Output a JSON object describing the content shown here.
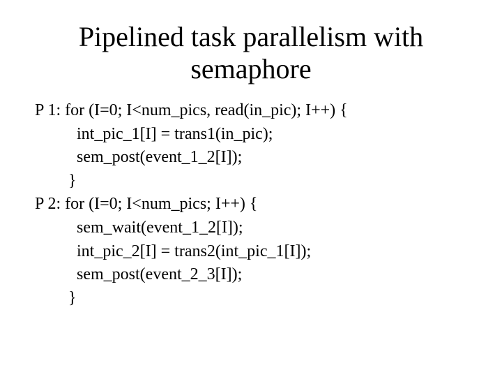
{
  "title_line1": "Pipelined task parallelism with",
  "title_line2": "semaphore",
  "code": {
    "l1": "P 1: for (I=0; I<num_pics, read(in_pic); I++) {",
    "l2": "int_pic_1[I] = trans1(in_pic);",
    "l3": "sem_post(event_1_2[I]);",
    "l4": "}",
    "l5": "P 2: for (I=0; I<num_pics; I++) {",
    "l6": "sem_wait(event_1_2[I]);",
    "l7": "int_pic_2[I] = trans2(int_pic_1[I]);",
    "l8": "sem_post(event_2_3[I]);",
    "l9": "}"
  }
}
